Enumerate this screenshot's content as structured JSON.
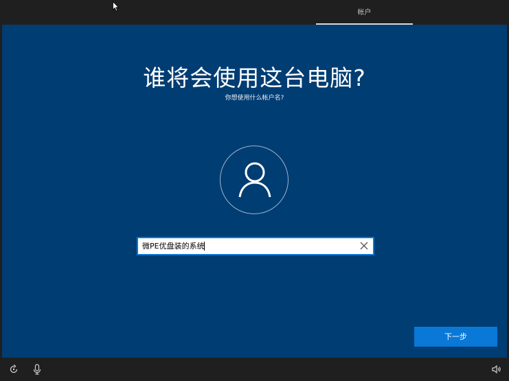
{
  "header": {
    "tab_label": "帐户"
  },
  "main": {
    "title": "谁将会使用这台电脑?",
    "subtitle": "你想使用什么帐户名?",
    "name_input": {
      "value": "微PE优盘装的系统"
    },
    "next_button_label": "下一步"
  },
  "bottom_bar": {
    "icons": [
      "ease-of-access-icon",
      "microphone-icon",
      "volume-icon"
    ]
  },
  "colors": {
    "panel_blue": "#003d73",
    "accent": "#0a78d7",
    "chrome": "#1f1f1f"
  }
}
